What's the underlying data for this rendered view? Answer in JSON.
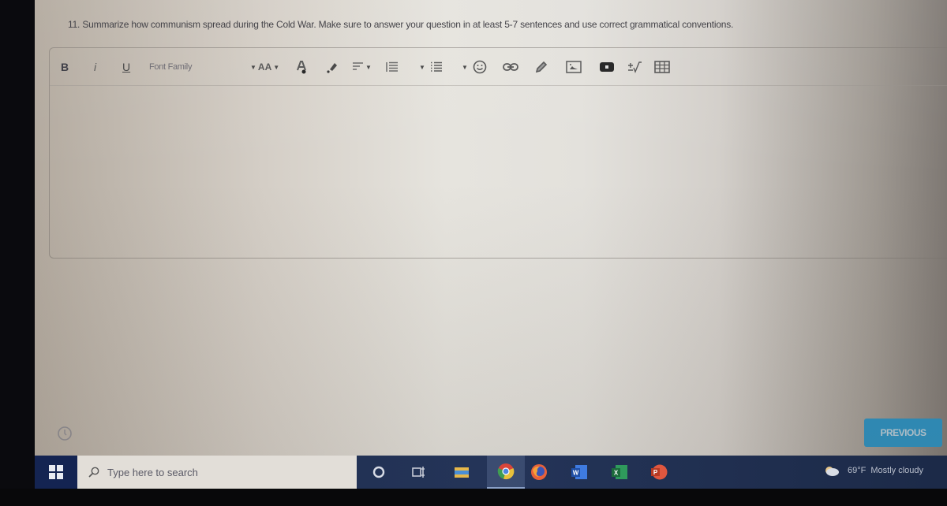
{
  "question": {
    "text": "11. Summarize how communism spread during the Cold War. Make sure to answer your question in at least 5-7 sentences and use correct grammatical conventions."
  },
  "editor": {
    "toolbar": {
      "bold": "B",
      "italic": "i",
      "underline": "U",
      "font_family": "Font Family",
      "font_size": "AA",
      "icons": [
        "bold-icon",
        "italic-icon",
        "underline-icon",
        "font-family-dropdown",
        "font-size-dropdown",
        "text-color-icon",
        "highlight-icon",
        "align-dropdown",
        "ordered-list-dropdown",
        "unordered-list-dropdown",
        "emoji-icon",
        "link-icon",
        "draw-icon",
        "image-icon",
        "video-icon",
        "math-icon",
        "table-icon"
      ]
    },
    "content": ""
  },
  "navigation": {
    "previous_label": "PREVIOUS"
  },
  "taskbar": {
    "search_placeholder": "Type here to search",
    "apps": [
      "cortana",
      "task-view",
      "file-explorer",
      "chrome",
      "firefox",
      "word",
      "excel",
      "powerpoint"
    ],
    "active_app": "chrome",
    "weather": {
      "temperature": "69°F",
      "condition": "Mostly cloudy"
    }
  },
  "colors": {
    "primary_button": "#2a8fbf",
    "taskbar": "#1e2d4d"
  }
}
